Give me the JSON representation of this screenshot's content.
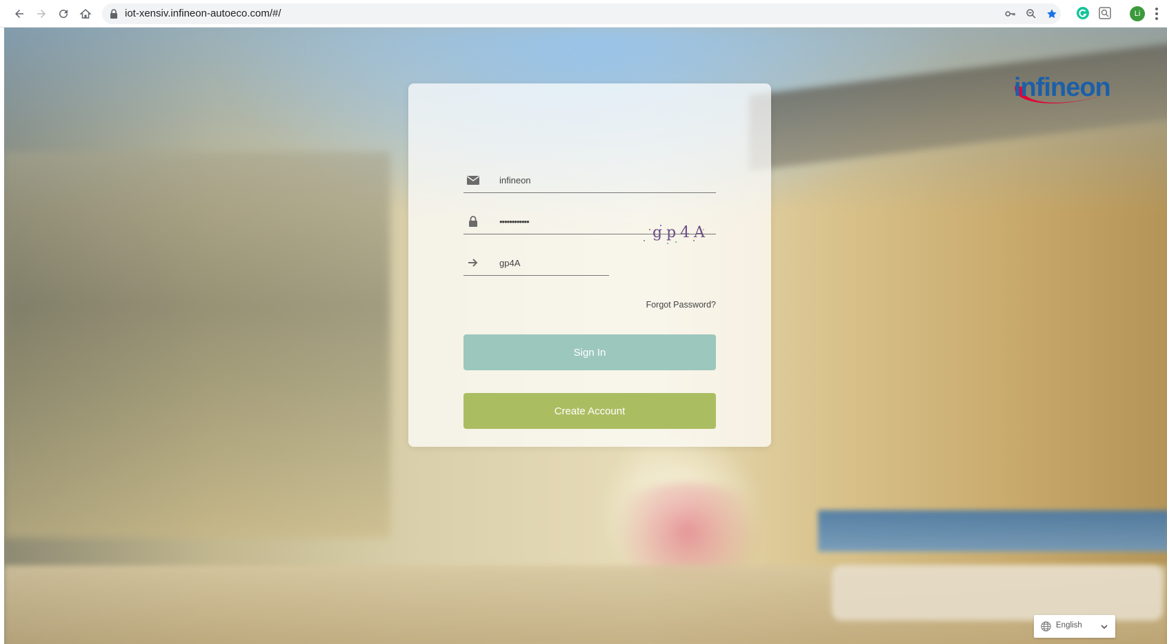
{
  "browser": {
    "url": "iot-xensiv.infineon-autoeco.com/#/",
    "profile_initial": "Li",
    "icons": [
      "back-icon",
      "forward-icon",
      "reload-icon",
      "home-icon",
      "lock-icon",
      "key-icon",
      "zoom-icon",
      "star-icon",
      "grammarly-icon",
      "search-extension-icon"
    ]
  },
  "logo": {
    "text": "infineon"
  },
  "login": {
    "username_value": "infineon",
    "password_value": "••••••••••••",
    "captcha_value": "gp4A",
    "captcha_image_text": "gp4A",
    "forgot_label": "Forgot Password?",
    "signin_label": "Sign In",
    "create_label": "Create Account",
    "signin_color": "#9cc7bd",
    "create_color": "#abbd61"
  },
  "language": {
    "selected": "English"
  }
}
